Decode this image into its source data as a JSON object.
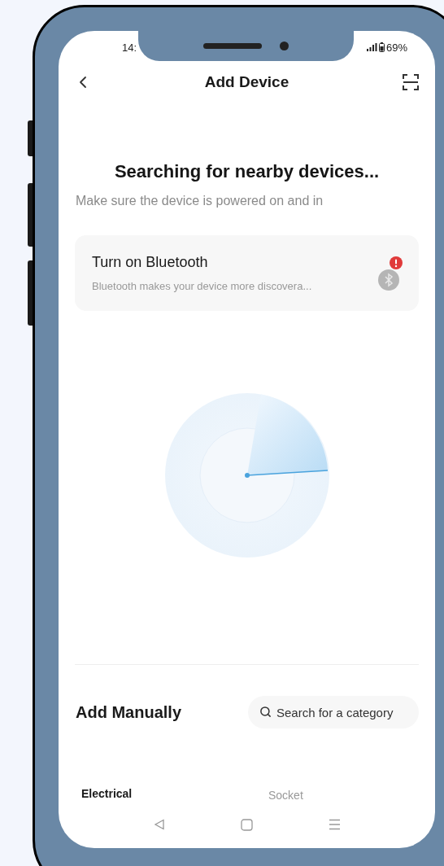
{
  "status_bar": {
    "time": "14:",
    "battery": "69%"
  },
  "header": {
    "title": "Add Device"
  },
  "search_status": {
    "title": "Searching for nearby devices...",
    "subtitle": "Make sure the device is powered on and in"
  },
  "bluetooth_card": {
    "title": "Turn on Bluetooth",
    "description": "Bluetooth makes your device more discovera...",
    "alert": true
  },
  "manual": {
    "title": "Add Manually",
    "search": {
      "placeholder": "Search for a category"
    }
  },
  "category_sidebar": [
    {
      "label": "Electrical",
      "selected": true
    }
  ],
  "devices": [
    {
      "label": "Socket"
    }
  ]
}
